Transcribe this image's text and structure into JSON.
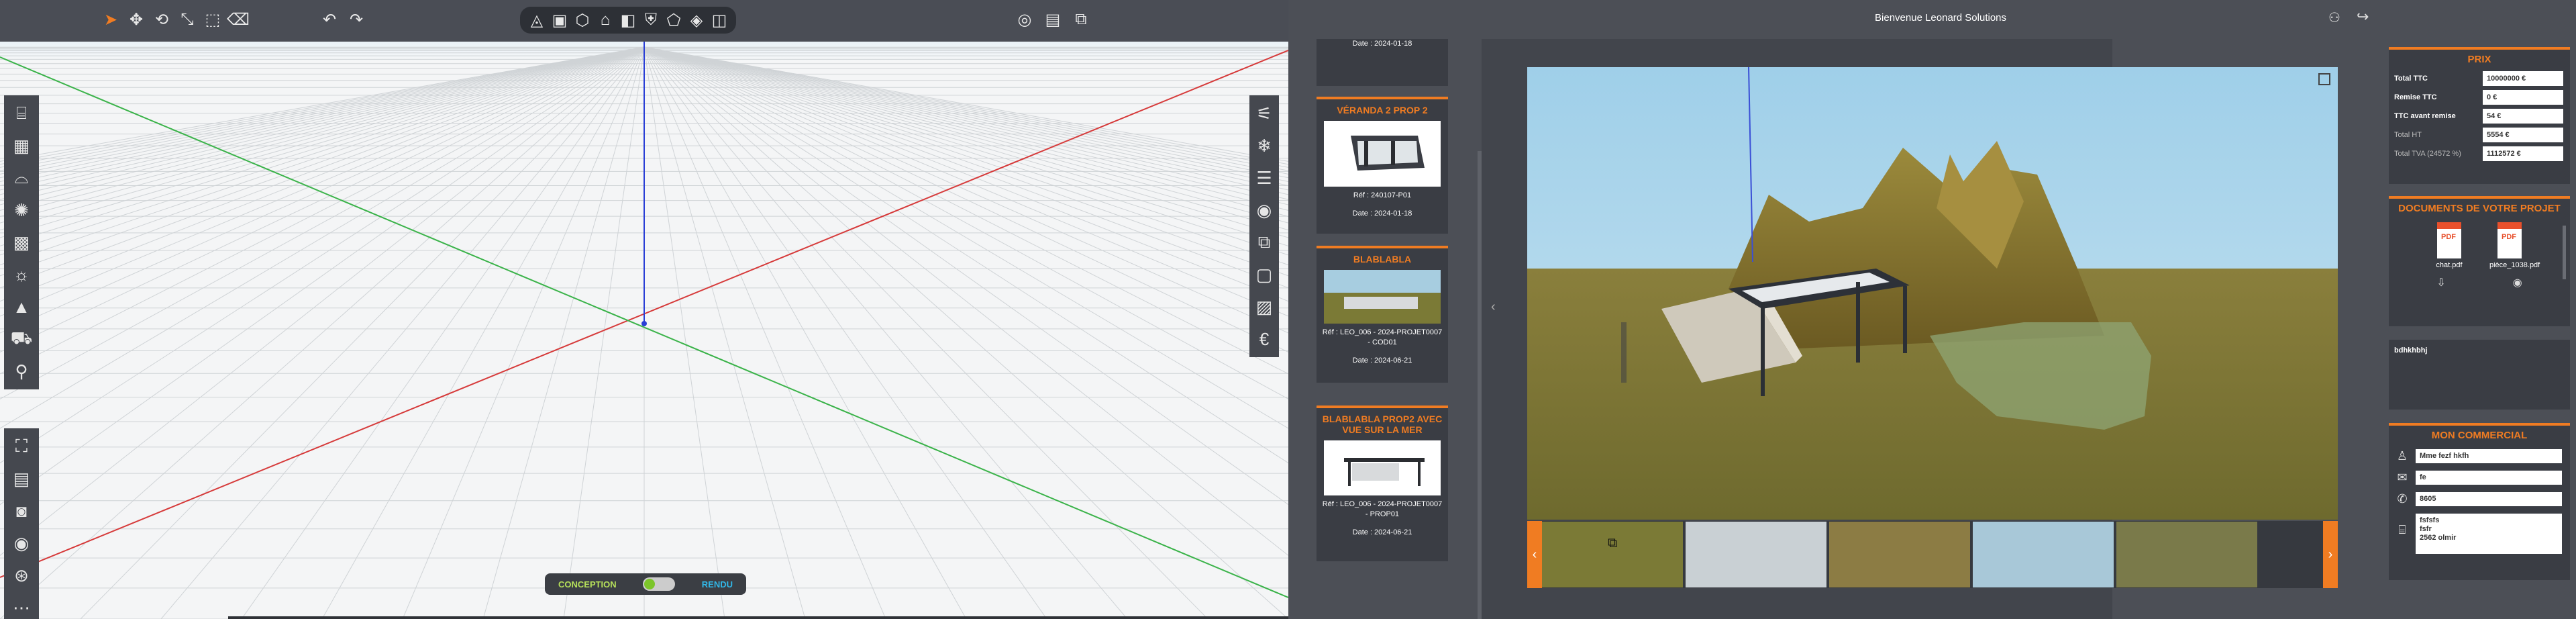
{
  "toolbar": {
    "left_tools": [
      "select-icon",
      "move-icon",
      "rotate-icon",
      "scale-icon",
      "measure-icon",
      "erase-icon"
    ],
    "history": [
      "undo-icon",
      "redo-icon"
    ],
    "views": [
      "perspective-view-icon",
      "front-view-icon",
      "3d-box-icon",
      "home-view-icon",
      "side-view-icon",
      "shield-view-icon",
      "top-view-icon",
      "cube-view-icon",
      "split-view-icon"
    ],
    "right_tools": [
      "globe-icon",
      "save-icon",
      "export-icon"
    ]
  },
  "left_sidebar": {
    "group1": [
      "building-icon",
      "facade-icon",
      "ceiling-icon",
      "snowflake-icon",
      "grid-icon",
      "lightbulb-icon",
      "mountain-icon",
      "car-icon",
      "pin-icon"
    ],
    "group2": [
      "furniture-icon",
      "document-icon",
      "camera-icon",
      "gauge-icon",
      "lifebuoy-icon",
      "more-icon"
    ]
  },
  "right_sidebar_tools": [
    "sliders-icon",
    "snowflake-icon",
    "layers-icon",
    "eye-icon",
    "copy-icon",
    "document-icon",
    "hatch-icon",
    "euro-icon"
  ],
  "mode_toggle": {
    "left": "CONCEPTION",
    "right": "RENDU"
  },
  "header": {
    "welcome": "Bienvenue Leonard Solutions"
  },
  "projects": [
    {
      "title": "",
      "ref": "",
      "date": "Date : 2024-01-18"
    },
    {
      "title": "VÉRANDA 2 PROP 2",
      "ref": "Réf : 240107-P01",
      "date": "Date : 2024-01-18"
    },
    {
      "title": "BLABLABLA",
      "ref": "Réf : LEO_006 - 2024-PROJET0007 - COD01",
      "date": "Date : 2024-06-21"
    },
    {
      "title": "BLABLABLA PROP2 AVEC VUE SUR LA MER",
      "ref": "Réf : LEO_006 - 2024-PROJET0007 - PROP01",
      "date": "Date : 2024-06-21"
    }
  ],
  "prix": {
    "title": "PRIX",
    "rows": [
      {
        "label": "Total TTC",
        "value": "10000000 €",
        "dim": false
      },
      {
        "label": "Remise TTC",
        "value": "0 €",
        "dim": false
      },
      {
        "label": "TTC avant remise",
        "value": "54 €",
        "dim": false
      },
      {
        "label": "Total HT",
        "value": "5554 €",
        "dim": true
      },
      {
        "label": "Total TVA (24572 %)",
        "value": "1112572 €",
        "dim": true
      }
    ]
  },
  "documents": {
    "title": "DOCUMENTS DE VOTRE PROJET",
    "files": [
      {
        "name": "chat.pdf"
      },
      {
        "name": "pièce_1038.pdf"
      }
    ]
  },
  "notes": {
    "text": "bdhkhbhj"
  },
  "commercial": {
    "title": "MON COMMERCIAL",
    "name": "Mme fezf hkfh",
    "email": "fe",
    "phone": "8605",
    "address": "fsfsfs\nfsfr\n2562 olmir"
  },
  "colors": {
    "accent": "#f07c22",
    "panel": "#4c4f56",
    "dark": "#3a3d44"
  }
}
